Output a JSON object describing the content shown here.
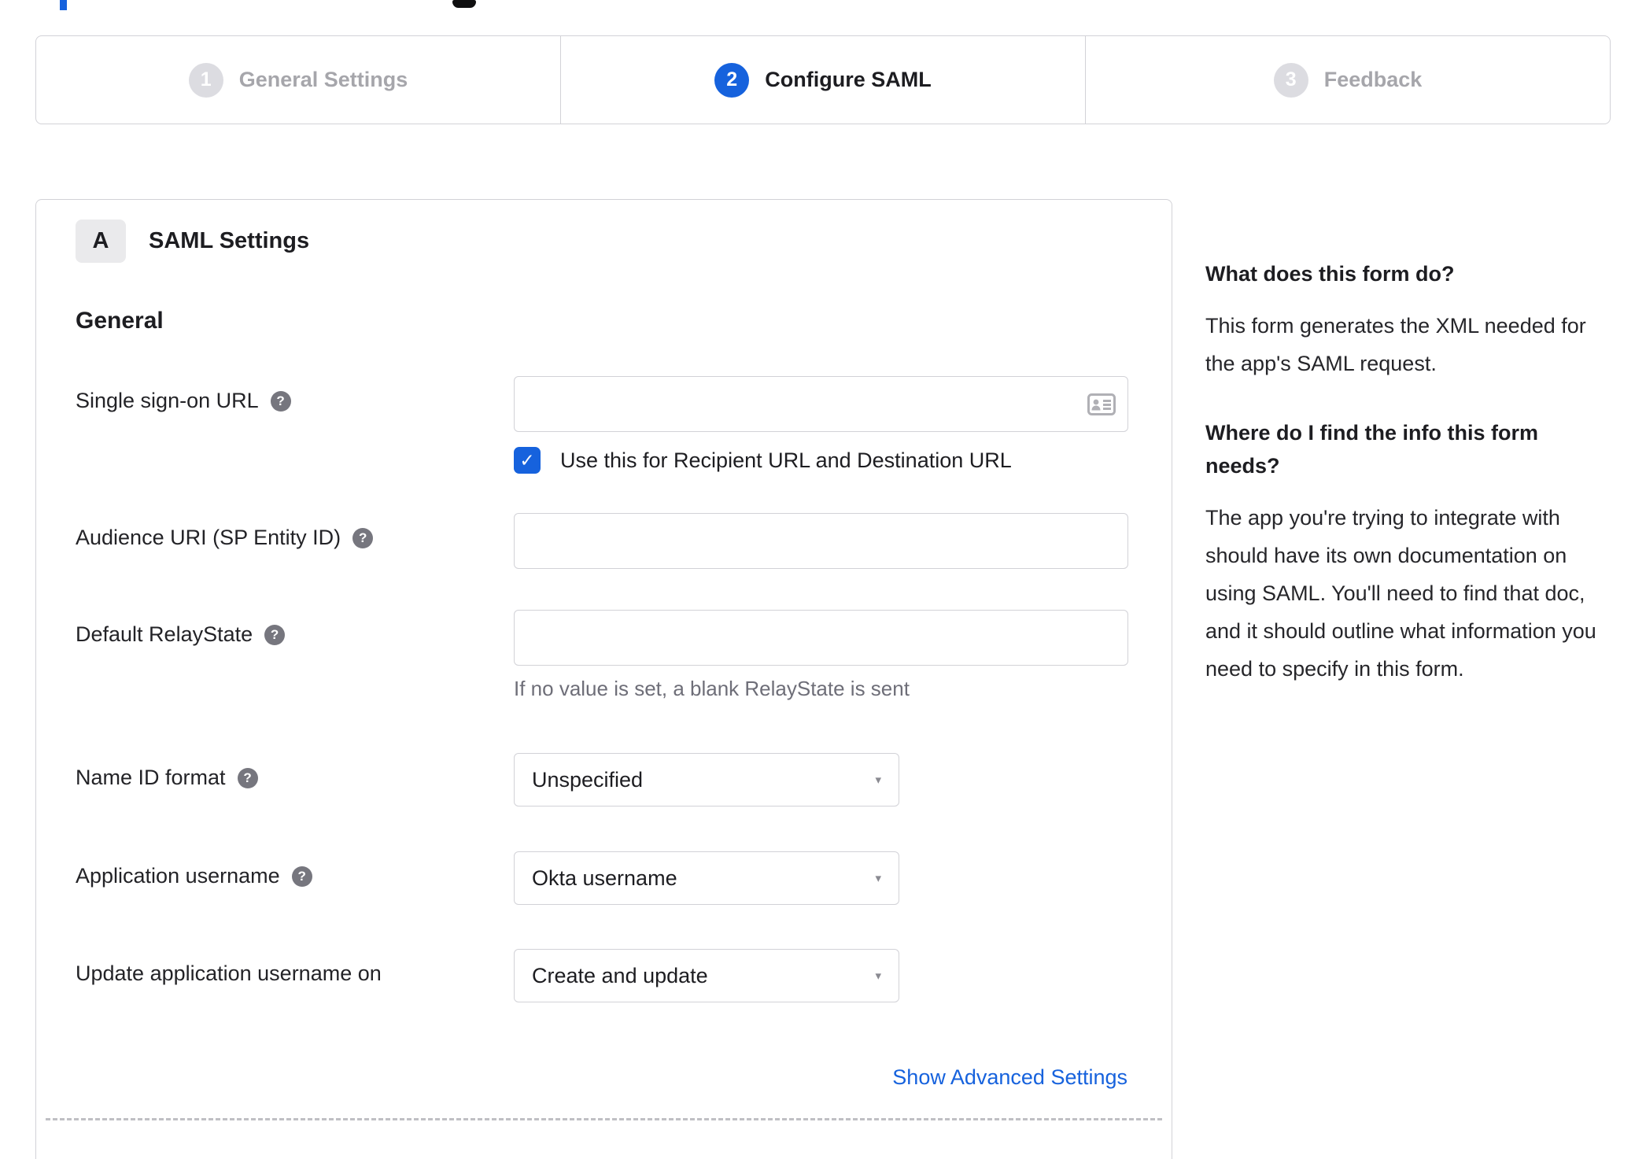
{
  "stepper": {
    "steps": [
      {
        "number": "1",
        "label": "General Settings"
      },
      {
        "number": "2",
        "label": "Configure SAML"
      },
      {
        "number": "3",
        "label": "Feedback"
      }
    ]
  },
  "saml_panel": {
    "badge": "A",
    "title": "SAML Settings",
    "section": "General",
    "sso_url": {
      "label": "Single sign-on URL",
      "value": "",
      "checkbox_label": "Use this for Recipient URL and Destination URL",
      "checkbox_checked": true
    },
    "audience_uri": {
      "label": "Audience URI (SP Entity ID)",
      "value": ""
    },
    "relay_state": {
      "label": "Default RelayState",
      "value": "",
      "hint": "If no value is set, a blank RelayState is sent"
    },
    "name_id_format": {
      "label": "Name ID format",
      "value": "Unspecified"
    },
    "app_username": {
      "label": "Application username",
      "value": "Okta username"
    },
    "update_username": {
      "label": "Update application username on",
      "value": "Create and update"
    },
    "advanced_link": "Show Advanced Settings"
  },
  "help_sidebar": {
    "q1": "What does this form do?",
    "a1": "This form generates the XML needed for the app's SAML request.",
    "q2": "Where do I find the info this form needs?",
    "a2": "The app you're trying to integrate with should have its own documentation on using SAML. You'll need to find that doc, and it should outline what information you need to specify in this form."
  },
  "icons": {
    "help": "?",
    "check": "✓",
    "dropdown_arrow": "▾"
  },
  "colors": {
    "accent_blue": "#1662dd",
    "inactive_gray": "#a6a6ab",
    "border": "#d2d2d7",
    "text_dark": "#1d1d21",
    "text_secondary": "#6e6e78"
  }
}
